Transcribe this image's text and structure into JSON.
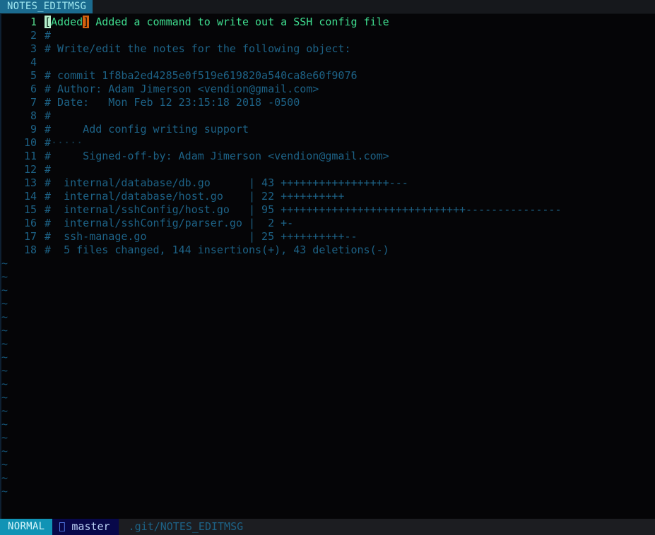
{
  "tabline": {
    "tabs": [
      {
        "label": "NOTES_EDITMSG",
        "active": true
      }
    ]
  },
  "editor": {
    "cursor_line": 1,
    "total_visible_lines": 18,
    "trailing_ws_glyph": "·",
    "lines": [
      {
        "num": "1",
        "type": "title",
        "cursor_char": "[",
        "word": "Added",
        "match_char": "]",
        "rest": " Added a command to write out a SSH config file"
      },
      {
        "num": "2",
        "type": "comment",
        "text": "#"
      },
      {
        "num": "3",
        "type": "comment",
        "text": "# Write/edit the notes for the following object:"
      },
      {
        "num": "4",
        "type": "blank",
        "text": ""
      },
      {
        "num": "5",
        "type": "comment",
        "text": "# commit 1f8ba2ed4285e0f519e619820a540ca8e60f9076"
      },
      {
        "num": "6",
        "type": "comment",
        "text": "# Author: Adam Jimerson <vendion@gmail.com>"
      },
      {
        "num": "7",
        "type": "comment",
        "text": "# Date:   Mon Feb 12 23:15:18 2018 -0500"
      },
      {
        "num": "8",
        "type": "comment",
        "text": "#"
      },
      {
        "num": "9",
        "type": "comment",
        "text": "#     Add config writing support"
      },
      {
        "num": "10",
        "type": "comment_ws",
        "text": "#",
        "trailing_ws": "·····"
      },
      {
        "num": "11",
        "type": "comment",
        "text": "#     Signed-off-by: Adam Jimerson <vendion@gmail.com>"
      },
      {
        "num": "12",
        "type": "comment",
        "text": "#"
      },
      {
        "num": "13",
        "type": "comment",
        "text": "#  internal/database/db.go      | 43 +++++++++++++++++---"
      },
      {
        "num": "14",
        "type": "comment",
        "text": "#  internal/database/host.go    | 22 ++++++++++"
      },
      {
        "num": "15",
        "type": "comment",
        "text": "#  internal/sshConfig/host.go   | 95 +++++++++++++++++++++++++++++---------------"
      },
      {
        "num": "16",
        "type": "comment",
        "text": "#  internal/sshConfig/parser.go |  2 +-"
      },
      {
        "num": "17",
        "type": "comment",
        "text": "#  ssh-manage.go                | 25 ++++++++++--"
      },
      {
        "num": "18",
        "type": "comment",
        "text": "#  5 files changed, 144 insertions(+), 43 deletions(-)"
      }
    ],
    "filler_char": "~",
    "filler_count": 18
  },
  "statusline": {
    "mode": "NORMAL",
    "branch_icon": "",
    "branch": "master",
    "file": ".git/NOTES_EDITMSG"
  },
  "colors": {
    "background": "#050507",
    "tab_active_bg": "#1b6b8f",
    "tab_active_fg": "#9fe7f0",
    "comment": "#1d6286",
    "title_green": "#3fdd8f",
    "cursor_bg": "#b6f0cd",
    "match_bracket_bg": "#d4600f",
    "mode_bg": "#1193b5",
    "branch_bg": "#08084a",
    "file_bg": "#1c1d21",
    "line_number": "#1d6286",
    "line_number_current": "#53d68a",
    "tilde": "#15567a"
  }
}
